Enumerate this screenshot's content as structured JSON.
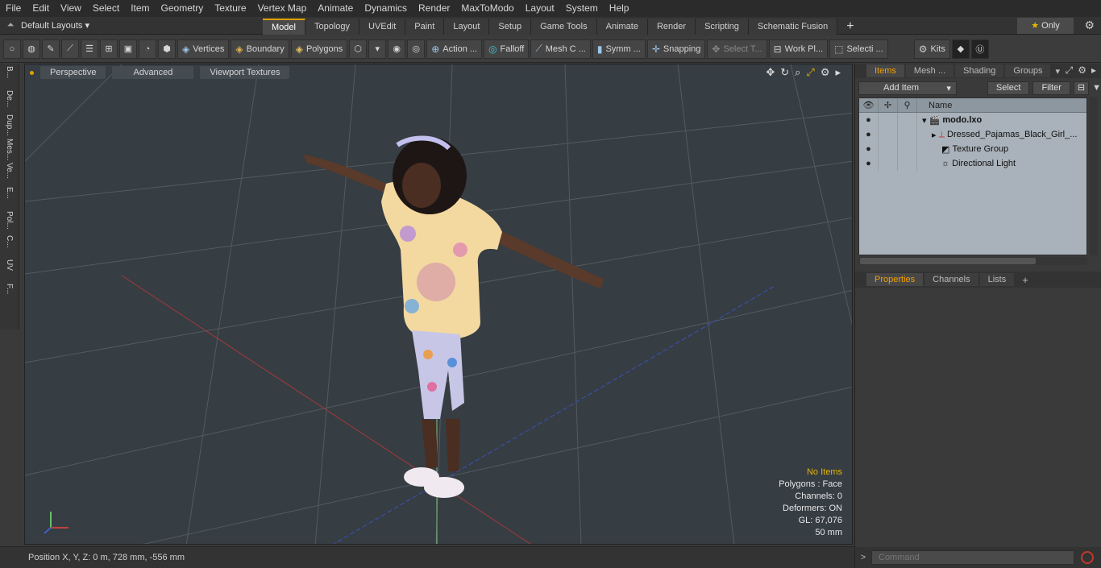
{
  "menu": [
    "File",
    "Edit",
    "View",
    "Select",
    "Item",
    "Geometry",
    "Texture",
    "Vertex Map",
    "Animate",
    "Dynamics",
    "Render",
    "MaxToModo",
    "Layout",
    "System",
    "Help"
  ],
  "layout": {
    "dropdown": "Default Layouts",
    "tabs": [
      "Model",
      "Topology",
      "UVEdit",
      "Paint",
      "Layout",
      "Setup",
      "Game Tools",
      "Animate",
      "Render",
      "Scripting",
      "Schematic Fusion"
    ],
    "active_tab": "Model",
    "only_label": "Only"
  },
  "toolbar": {
    "vertices": "Vertices",
    "boundary": "Boundary",
    "polygons": "Polygons",
    "action": "Action ...",
    "falloff": "Falloff",
    "mesh": "Mesh C ...",
    "symm": "Symm ...",
    "snapping": "Snapping",
    "select_t": "Select T...",
    "work_pl": "Work Pl...",
    "selecti": "Selecti ...",
    "kits": "Kits"
  },
  "left_strip": [
    "B...",
    "De...",
    "Dup...",
    "Mes...",
    "Ve...",
    "E...",
    "Pol...",
    "C...",
    "UV",
    "F..."
  ],
  "viewport": {
    "perspective": "Perspective",
    "advanced": "Advanced",
    "textures": "Viewport Textures",
    "stats": {
      "items": "No Items",
      "polygons": "Polygons : Face",
      "channels": "Channels: 0",
      "deformers": "Deformers: ON",
      "gl": "GL: 67,076",
      "size": "50 mm"
    }
  },
  "status": {
    "position": "Position X, Y, Z:   0 m, 728 mm, -556 mm"
  },
  "items_panel": {
    "tabs": [
      "Items",
      "Mesh ...",
      "Shading",
      "Groups"
    ],
    "add_item": "Add Item",
    "select": "Select",
    "filter": "Filter",
    "name_header": "Name",
    "rows": [
      "modo.lxo",
      "Dressed_Pajamas_Black_Girl_...",
      "Texture Group",
      "Directional Light"
    ]
  },
  "props_panel": {
    "tabs": [
      "Properties",
      "Channels",
      "Lists"
    ]
  },
  "command": {
    "placeholder": "Command"
  }
}
